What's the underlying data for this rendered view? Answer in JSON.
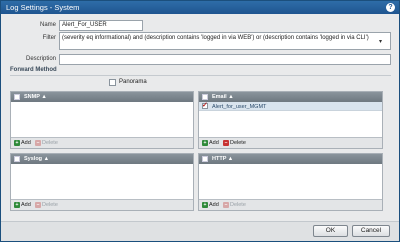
{
  "dialog": {
    "title": "Log Settings - System"
  },
  "form": {
    "name_label": "Name",
    "name_value": "Alert_For_USER",
    "filter_label": "Filter",
    "filter_value": "(severity eq informational) and (description contains 'logged in via WEB') or (description contains 'logged in via CLI')",
    "description_label": "Description",
    "description_value": ""
  },
  "forward_method": {
    "title": "Forward Method",
    "panorama_label": "Panorama",
    "panorama_checked": false
  },
  "panels": {
    "snmp": {
      "title": "SNMP",
      "add": "Add",
      "delete": "Delete"
    },
    "email": {
      "title": "Email",
      "add": "Add",
      "delete": "Delete",
      "rows": [
        {
          "label": "Alert_for_user_MGMT",
          "checked": true
        }
      ]
    },
    "syslog": {
      "title": "Syslog",
      "add": "Add",
      "delete": "Delete"
    },
    "http": {
      "title": "HTTP",
      "add": "Add",
      "delete": "Delete"
    }
  },
  "buttons": {
    "ok": "OK",
    "cancel": "Cancel"
  },
  "icons": {
    "help": "help-icon",
    "add": "add-icon",
    "delete": "delete-icon",
    "sort": "sort-icon"
  },
  "colors": {
    "titlebar": "#1f5590",
    "panel_header": "#7a848c",
    "add": "#2f8a3a",
    "delete": "#c73232"
  }
}
